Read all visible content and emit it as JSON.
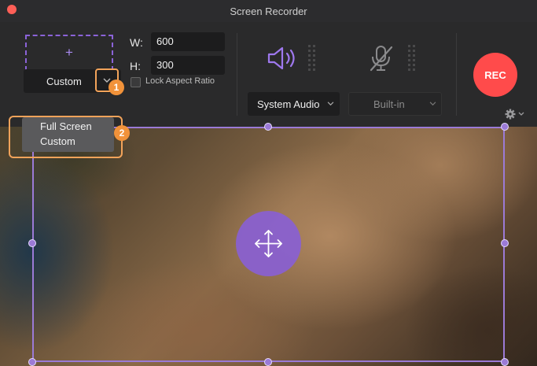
{
  "window": {
    "title": "Screen Recorder"
  },
  "capture_area": {
    "add_symbol": "+",
    "width_label": "W:",
    "width_value": "600",
    "height_label": "H:",
    "height_value": "300"
  },
  "size_select": {
    "value": "Custom"
  },
  "lock_aspect": {
    "label": "Lock Aspect Ratio",
    "checked": false
  },
  "dropdown_menu": {
    "items": [
      "Full Screen",
      "Custom"
    ]
  },
  "audio": {
    "system": "System Audio",
    "microphone": "Built-in"
  },
  "record_button": {
    "label": "REC"
  },
  "annotations": {
    "step1": "1",
    "step2": "2"
  },
  "colors": {
    "accent": "#8b63d8",
    "rec": "#ff4b4b",
    "callout": "#f1923a"
  }
}
